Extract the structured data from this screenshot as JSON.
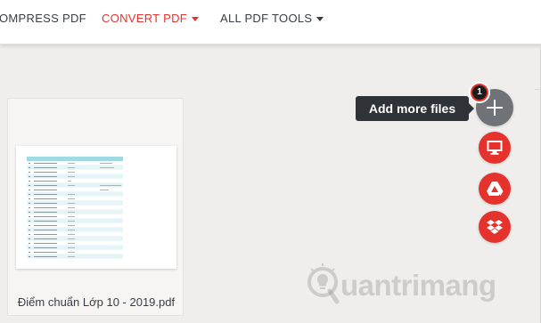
{
  "nav": {
    "items": [
      {
        "label": "OMPRESS PDF"
      },
      {
        "label": "CONVERT PDF"
      },
      {
        "label": "ALL PDF TOOLS"
      }
    ]
  },
  "file": {
    "name": "Điểm chuẩn Lớp 10 - 2019.pdf"
  },
  "actions": {
    "tooltip": "Add more files",
    "badge_count": "1",
    "buttons": [
      {
        "icon": "plus-icon"
      },
      {
        "icon": "computer-icon"
      },
      {
        "icon": "google-drive-icon"
      },
      {
        "icon": "dropbox-icon"
      }
    ]
  },
  "watermark": {
    "text": "uantrimang"
  },
  "colors": {
    "brand_red": "#e5322d",
    "add_button": "#6f7378",
    "tooltip_bg": "#2f3237",
    "page_bg": "#f0eeec",
    "table_head": "#9fd9e4"
  }
}
